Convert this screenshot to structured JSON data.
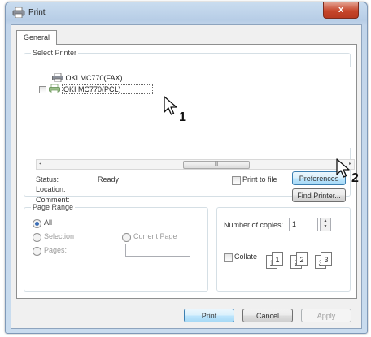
{
  "window": {
    "title": "Print",
    "close_glyph": "x"
  },
  "tabs": [
    {
      "label": "General"
    }
  ],
  "select_printer": {
    "label": "Select Printer",
    "printers": [
      {
        "name": "OKI MC770(FAX)",
        "icon": "printer-icon"
      },
      {
        "name": "OKI MC770(PCL)",
        "icon": "printer-icon",
        "selected": true
      }
    ],
    "scrollbar": {
      "left": "◂",
      "thumb": "|||",
      "right": "▸"
    }
  },
  "status": {
    "status_label": "Status:",
    "status_value": "Ready",
    "location_label": "Location:",
    "comment_label": "Comment:",
    "print_to_file": "Print to file",
    "preferences_button": "Preferences",
    "find_printer_button": "Find Printer..."
  },
  "page_range": {
    "label": "Page Range",
    "all": "All",
    "selection": "Selection",
    "current_page": "Current Page",
    "pages": "Pages:"
  },
  "copies": {
    "number_label": "Number of copies:",
    "number_value": "1",
    "collate": "Collate",
    "collate_pages": [
      "1",
      "1",
      "2",
      "2",
      "3",
      "3"
    ]
  },
  "buttons": {
    "print": "Print",
    "cancel": "Cancel",
    "apply": "Apply"
  },
  "annotations": {
    "step1": "1",
    "step2": "2"
  },
  "colors": {
    "accent": "#3c7fb1",
    "close": "#c6452a",
    "selection": "#3399ff"
  }
}
